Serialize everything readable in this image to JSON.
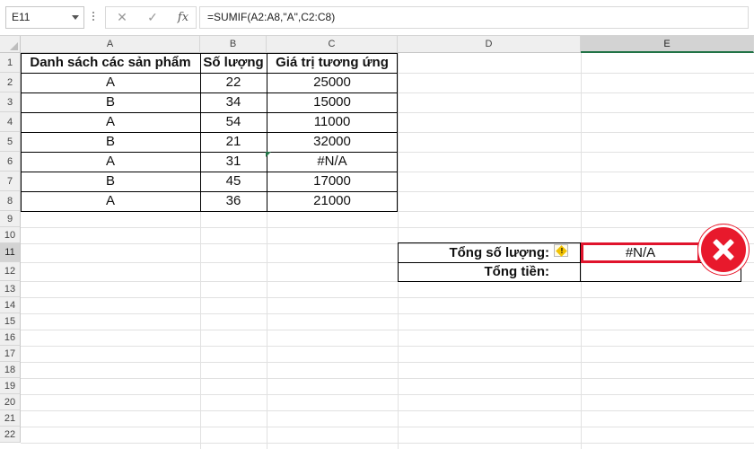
{
  "formula_bar": {
    "name_box": "E11",
    "cancel_icon": "✕",
    "enter_icon": "✓",
    "fx_label": "fx",
    "formula": "=SUMIF(A2:A8,\"A\",C2:C8)"
  },
  "columns": [
    "A",
    "B",
    "C",
    "D",
    "E"
  ],
  "rows": [
    "1",
    "2",
    "3",
    "4",
    "5",
    "6",
    "7",
    "8",
    "9",
    "10",
    "11",
    "12",
    "13",
    "14",
    "15",
    "16",
    "17",
    "18",
    "19",
    "20",
    "21",
    "22"
  ],
  "table": {
    "headers": [
      "Danh sách các sản phẩm",
      "Số lượng",
      "Giá trị tương ứng"
    ],
    "rows": [
      [
        "A",
        "22",
        "25000"
      ],
      [
        "B",
        "34",
        "15000"
      ],
      [
        "A",
        "54",
        "11000"
      ],
      [
        "B",
        "21",
        "32000"
      ],
      [
        "A",
        "31",
        "#N/A"
      ],
      [
        "B",
        "45",
        "17000"
      ],
      [
        "A",
        "36",
        "21000"
      ]
    ]
  },
  "summary": {
    "total_qty_label": "Tổng số lượng:",
    "total_qty_value": "#N/A",
    "total_amount_label": "Tổng tiền:",
    "total_amount_value": ""
  },
  "colors": {
    "error_badge": "#e8192c",
    "selection_border": "#e0142c",
    "excel_green": "#217346"
  },
  "icons": {
    "error_indicator": "warning-diamond-icon",
    "error_badge": "x-circle-icon"
  }
}
